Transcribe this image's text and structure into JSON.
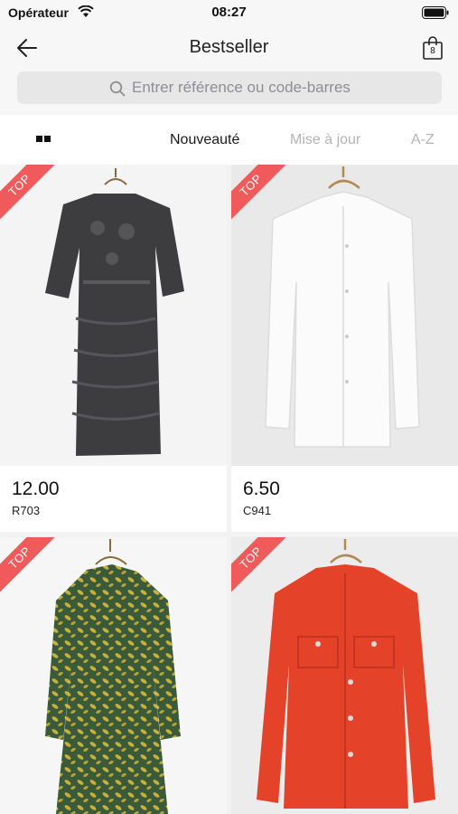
{
  "status_bar": {
    "carrier": "Opérateur",
    "time": "08:27"
  },
  "header": {
    "title": "Bestseller",
    "cart_count": "8"
  },
  "search": {
    "placeholder": "Entrer référence ou code-barres"
  },
  "sort_tabs": [
    {
      "label": "Nouveauté",
      "active": true
    },
    {
      "label": "Mise à jour",
      "active": false
    },
    {
      "label": "A-Z",
      "active": false
    }
  ],
  "products": [
    {
      "badge": "TOP",
      "price": "12.00",
      "sku": "R703",
      "garment": "grey lace tiered dress"
    },
    {
      "badge": "TOP",
      "price": "6.50",
      "sku": "C941",
      "garment": "white eyelet blouse"
    },
    {
      "badge": "TOP",
      "price": "",
      "sku": "",
      "garment": "green patterned dress"
    },
    {
      "badge": "TOP",
      "price": "",
      "sku": "",
      "garment": "red denim jacket"
    }
  ],
  "colors": {
    "ribbon": "#f05a5a",
    "accent_text": "#111111",
    "inactive_tab": "#b3b3b3"
  }
}
